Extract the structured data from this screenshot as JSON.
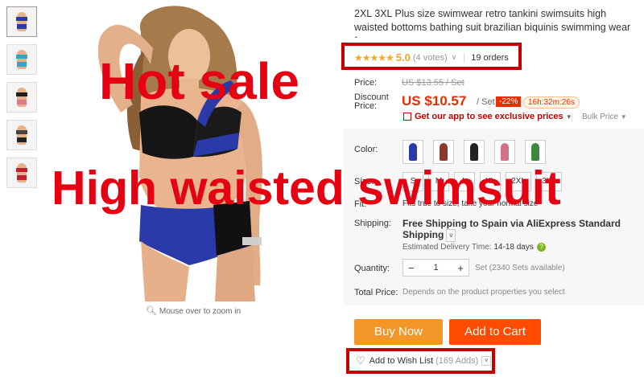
{
  "thumbnails": [
    {
      "name": "thumb-blue-black",
      "accent": "#2a3aa8",
      "bottom": "#2a3aa8"
    },
    {
      "name": "thumb-teal",
      "accent": "#35a3c2",
      "bottom": "#35a3c2"
    },
    {
      "name": "thumb-black-pink",
      "accent": "#1e1e1e",
      "bottom": "#d87a8c"
    },
    {
      "name": "thumb-stripe",
      "accent": "#444",
      "bottom": "#222"
    },
    {
      "name": "thumb-red",
      "accent": "#c02030",
      "bottom": "#c02030"
    }
  ],
  "image": {
    "zoom_hint": "Mouse over to zoom in",
    "zoom_icon": "search-icon"
  },
  "overlay": {
    "line1": "Hot sale",
    "line2": "High waisted swimsuit"
  },
  "product": {
    "title": "2XL 3XL Plus size swimwear retro tankini swimsuits high waisted bottoms bathing suit brazilian biquinis swimming wear for women",
    "stars": "★★★★★",
    "rating": "5.0",
    "votes": "(4 votes)",
    "orders": "19 orders"
  },
  "price": {
    "label": "Price:",
    "original": "US $13.55 / Set",
    "discount_label_1": "Discount",
    "discount_label_2": "Price:",
    "current": "US $10.57",
    "unit": "/ Set",
    "discount": "-22%",
    "timer": "16h:32m:26s",
    "app_promo": "Get our app to see exclusive prices",
    "bulk": "Bulk Price"
  },
  "options": {
    "color_label": "Color:",
    "colors": [
      "#2a3aa8",
      "#8b3a2a",
      "#222222",
      "#d47088",
      "#3b8a3b"
    ],
    "size_label": "Size:",
    "sizes": [
      "S",
      "M",
      "L",
      "XL",
      "2XL",
      "3XL"
    ],
    "fit_label": "Fit:",
    "fit_text": "Fits true to size, take your normal size"
  },
  "shipping": {
    "label": "Shipping:",
    "text": "Free Shipping to Spain via AliExpress Standard Shipping",
    "estimate_label": "Estimated Delivery Time:",
    "estimate_value": "14-18 days"
  },
  "quantity": {
    "label": "Quantity:",
    "minus": "−",
    "value": "1",
    "plus": "+",
    "available": "Set (2340 Sets available)"
  },
  "total": {
    "label": "Total Price:",
    "text": "Depends on the product properties you select"
  },
  "actions": {
    "buy": "Buy Now",
    "cart": "Add to Cart",
    "wish": "Add to Wish List",
    "wish_adds": "(169 Adds)"
  },
  "colors": {
    "accent_red": "#c40000",
    "price_red": "#e62e04",
    "buy_orange": "#f29728",
    "cart_orange": "#ff4c00",
    "star": "#f5a623"
  }
}
